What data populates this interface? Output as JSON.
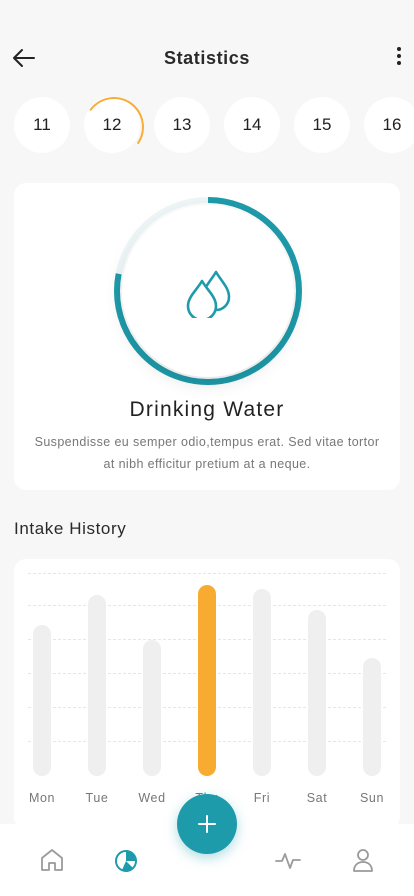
{
  "header": {
    "title": "Statistics",
    "back_icon": "arrow-left-icon",
    "menu_icon": "more-vertical-icon"
  },
  "dates": {
    "items": [
      "11",
      "12",
      "13",
      "14",
      "15",
      "16"
    ],
    "selected": "12"
  },
  "water_card": {
    "title": "Drinking Water",
    "description": "Suspendisse eu semper odio,tempus erat. Sed vitae tortor at nibh efficitur pretium at a neque.",
    "progress_fraction": 0.78,
    "icon": "water-drops-icon",
    "accent_color": "#1e9bab"
  },
  "intake_history": {
    "title": "Intake History",
    "highlight_color": "#f8ab31",
    "bar_color": "#efefef"
  },
  "chart_data": {
    "type": "bar",
    "categories": [
      "Mon",
      "Tue",
      "Wed",
      "Thu",
      "Fri",
      "Sat",
      "Sun"
    ],
    "values": [
      0.79,
      0.95,
      0.71,
      1.0,
      0.98,
      0.87,
      0.62
    ],
    "highlighted": "Thu",
    "ylim": [
      0,
      1
    ],
    "grid": true
  },
  "bottom_nav": {
    "items": [
      {
        "name": "home",
        "icon": "home-icon",
        "active": false
      },
      {
        "name": "statistics",
        "icon": "pie-chart-icon",
        "active": true
      },
      {
        "name": "activity",
        "icon": "pulse-icon",
        "active": false
      },
      {
        "name": "profile",
        "icon": "user-icon",
        "active": false
      }
    ],
    "fab_icon": "plus-icon"
  }
}
